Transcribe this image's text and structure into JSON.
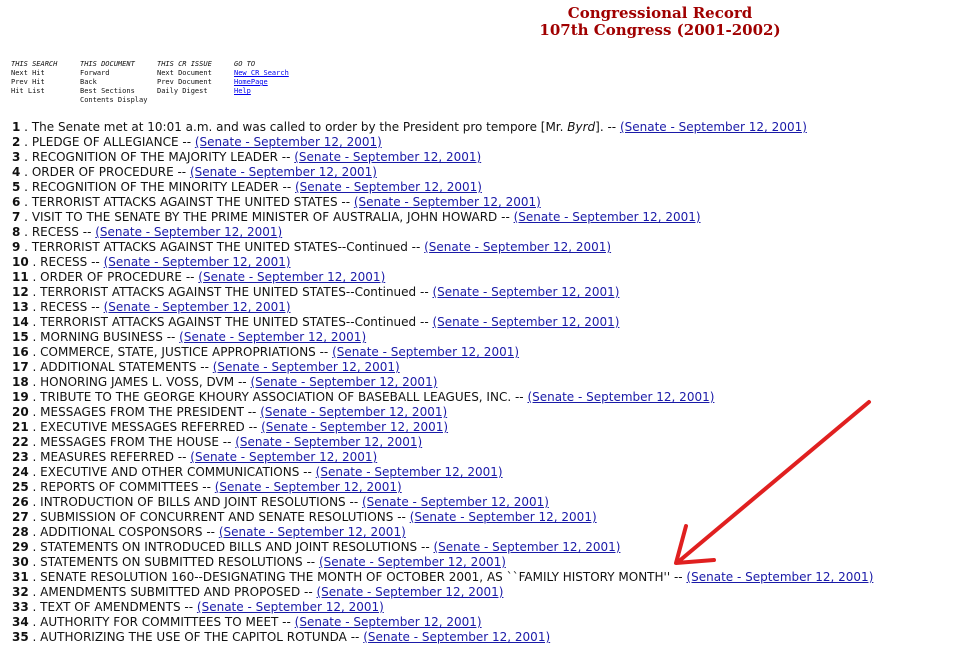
{
  "header": {
    "title": "Congressional Record",
    "subtitle": "107th Congress (2001-2002)"
  },
  "nav": {
    "this_search": {
      "heading": "THIS SEARCH",
      "items": [
        "Next Hit",
        "Prev Hit",
        "Hit List"
      ]
    },
    "this_document": {
      "heading": "THIS DOCUMENT",
      "items": [
        "Forward",
        "Back",
        "Best Sections",
        "Contents Display"
      ]
    },
    "this_cr_issue": {
      "heading": "THIS CR ISSUE",
      "items": [
        "Next Document",
        "Prev Document",
        "Daily Digest"
      ]
    },
    "go_to": {
      "heading": "GO TO",
      "links": [
        "New CR Search",
        "HomePage",
        "Help"
      ]
    }
  },
  "link_label": "(Senate - September 12, 2001)",
  "results": [
    {
      "n": "1",
      "pre": "The Senate met at 10:01 a.m. and was called to order by the President pro tempore [Mr. ",
      "em": "Byrd",
      "post": "]."
    },
    {
      "n": "2",
      "text": "PLEDGE OF ALLEGIANCE"
    },
    {
      "n": "3",
      "text": "RECOGNITION OF THE MAJORITY LEADER"
    },
    {
      "n": "4",
      "text": "ORDER OF PROCEDURE"
    },
    {
      "n": "5",
      "text": "RECOGNITION OF THE MINORITY LEADER"
    },
    {
      "n": "6",
      "text": "TERRORIST ATTACKS AGAINST THE UNITED STATES"
    },
    {
      "n": "7",
      "text": "VISIT TO THE SENATE BY THE PRIME MINISTER OF AUSTRALIA, JOHN HOWARD"
    },
    {
      "n": "8",
      "text": "RECESS"
    },
    {
      "n": "9",
      "text": "TERRORIST ATTACKS AGAINST THE UNITED STATES--Continued"
    },
    {
      "n": "10",
      "text": "RECESS"
    },
    {
      "n": "11",
      "text": "ORDER OF PROCEDURE"
    },
    {
      "n": "12",
      "text": "TERRORIST ATTACKS AGAINST THE UNITED STATES--Continued"
    },
    {
      "n": "13",
      "text": "RECESS"
    },
    {
      "n": "14",
      "text": "TERRORIST ATTACKS AGAINST THE UNITED STATES--Continued"
    },
    {
      "n": "15",
      "text": "MORNING BUSINESS"
    },
    {
      "n": "16",
      "text": "COMMERCE, STATE, JUSTICE APPROPRIATIONS"
    },
    {
      "n": "17",
      "text": "ADDITIONAL STATEMENTS"
    },
    {
      "n": "18",
      "text": "HONORING JAMES L. VOSS, DVM"
    },
    {
      "n": "19",
      "text": "TRIBUTE TO THE GEORGE KHOURY ASSOCIATION OF BASEBALL LEAGUES, INC."
    },
    {
      "n": "20",
      "text": "MESSAGES FROM THE PRESIDENT"
    },
    {
      "n": "21",
      "text": "EXECUTIVE MESSAGES REFERRED"
    },
    {
      "n": "22",
      "text": "MESSAGES FROM THE HOUSE"
    },
    {
      "n": "23",
      "text": "MEASURES REFERRED"
    },
    {
      "n": "24",
      "text": "EXECUTIVE AND OTHER COMMUNICATIONS"
    },
    {
      "n": "25",
      "text": "REPORTS OF COMMITTEES"
    },
    {
      "n": "26",
      "text": "INTRODUCTION OF BILLS AND JOINT RESOLUTIONS"
    },
    {
      "n": "27",
      "text": "SUBMISSION OF CONCURRENT AND SENATE RESOLUTIONS"
    },
    {
      "n": "28",
      "text": "ADDITIONAL COSPONSORS"
    },
    {
      "n": "29",
      "text": "STATEMENTS ON INTRODUCED BILLS AND JOINT RESOLUTIONS"
    },
    {
      "n": "30",
      "text": "STATEMENTS ON SUBMITTED RESOLUTIONS"
    },
    {
      "n": "31",
      "text": "SENATE RESOLUTION 160--DESIGNATING THE MONTH OF OCTOBER 2001, AS ``FAMILY HISTORY MONTH''"
    },
    {
      "n": "32",
      "text": "AMENDMENTS SUBMITTED AND PROPOSED"
    },
    {
      "n": "33",
      "text": "TEXT OF AMENDMENTS"
    },
    {
      "n": "34",
      "text": "AUTHORITY FOR COMMITTEES TO MEET"
    },
    {
      "n": "35",
      "text": "AUTHORIZING THE USE OF THE CAPITOL ROTUNDA"
    }
  ],
  "colors": {
    "header": "#a00000",
    "link": "#1a1aa8",
    "arrow": "#e02020"
  },
  "annotation": {
    "type": "arrow",
    "target_result": "31"
  }
}
